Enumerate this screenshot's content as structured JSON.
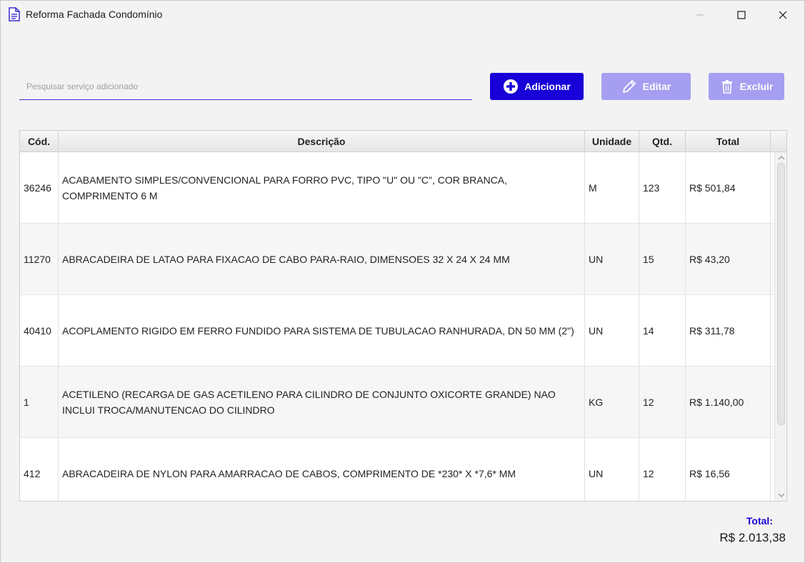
{
  "window": {
    "title": "Reforma Fachada Condomínio"
  },
  "search": {
    "placeholder": "Pesquisar serviço adicionado",
    "value": ""
  },
  "toolbar": {
    "add_label": "Adicionar",
    "edit_label": "Editar",
    "delete_label": "Excluir"
  },
  "table": {
    "headers": {
      "cod": "Cód.",
      "desc": "Descrição",
      "unidade": "Unidade",
      "qtd": "Qtd.",
      "total": "Total"
    },
    "rows": [
      {
        "cod": "36246",
        "desc": "ACABAMENTO SIMPLES/CONVENCIONAL PARA FORRO PVC, TIPO \"U\" OU \"C\", COR BRANCA, COMPRIMENTO 6 M",
        "unidade": "M",
        "qtd": "123",
        "total": "R$ 501,84"
      },
      {
        "cod": "11270",
        "desc": "ABRACADEIRA DE LATAO PARA FIXACAO DE CABO PARA-RAIO, DIMENSOES 32 X 24 X 24 MM",
        "unidade": "UN",
        "qtd": "15",
        "total": "R$ 43,20"
      },
      {
        "cod": "40410",
        "desc": "ACOPLAMENTO RIGIDO EM FERRO FUNDIDO PARA SISTEMA DE TUBULACAO RANHURADA, DN 50 MM (2\")",
        "unidade": "UN",
        "qtd": "14",
        "total": "R$ 311,78"
      },
      {
        "cod": "1",
        "desc": "ACETILENO (RECARGA DE GAS ACETILENO PARA CILINDRO DE CONJUNTO OXICORTE GRANDE) NAO INCLUI TROCA/MANUTENCAO DO CILINDRO",
        "unidade": "KG",
        "qtd": "12",
        "total": "R$ 1.140,00"
      },
      {
        "cod": "412",
        "desc": "ABRACADEIRA DE NYLON PARA AMARRACAO DE CABOS, COMPRIMENTO DE *230* X *7,6* MM",
        "unidade": "UN",
        "qtd": "12",
        "total": "R$ 16,56"
      }
    ]
  },
  "summary": {
    "total_label": "Total:",
    "total_value": "R$ 2.013,38"
  },
  "colors": {
    "accent": "#1800d8",
    "accent_disabled": "#a69ef0",
    "row_alt": "#f6f6f6"
  },
  "icons": {
    "app": "document-icon",
    "add": "plus-circle-icon",
    "edit": "pencil-icon",
    "delete": "trash-icon"
  }
}
